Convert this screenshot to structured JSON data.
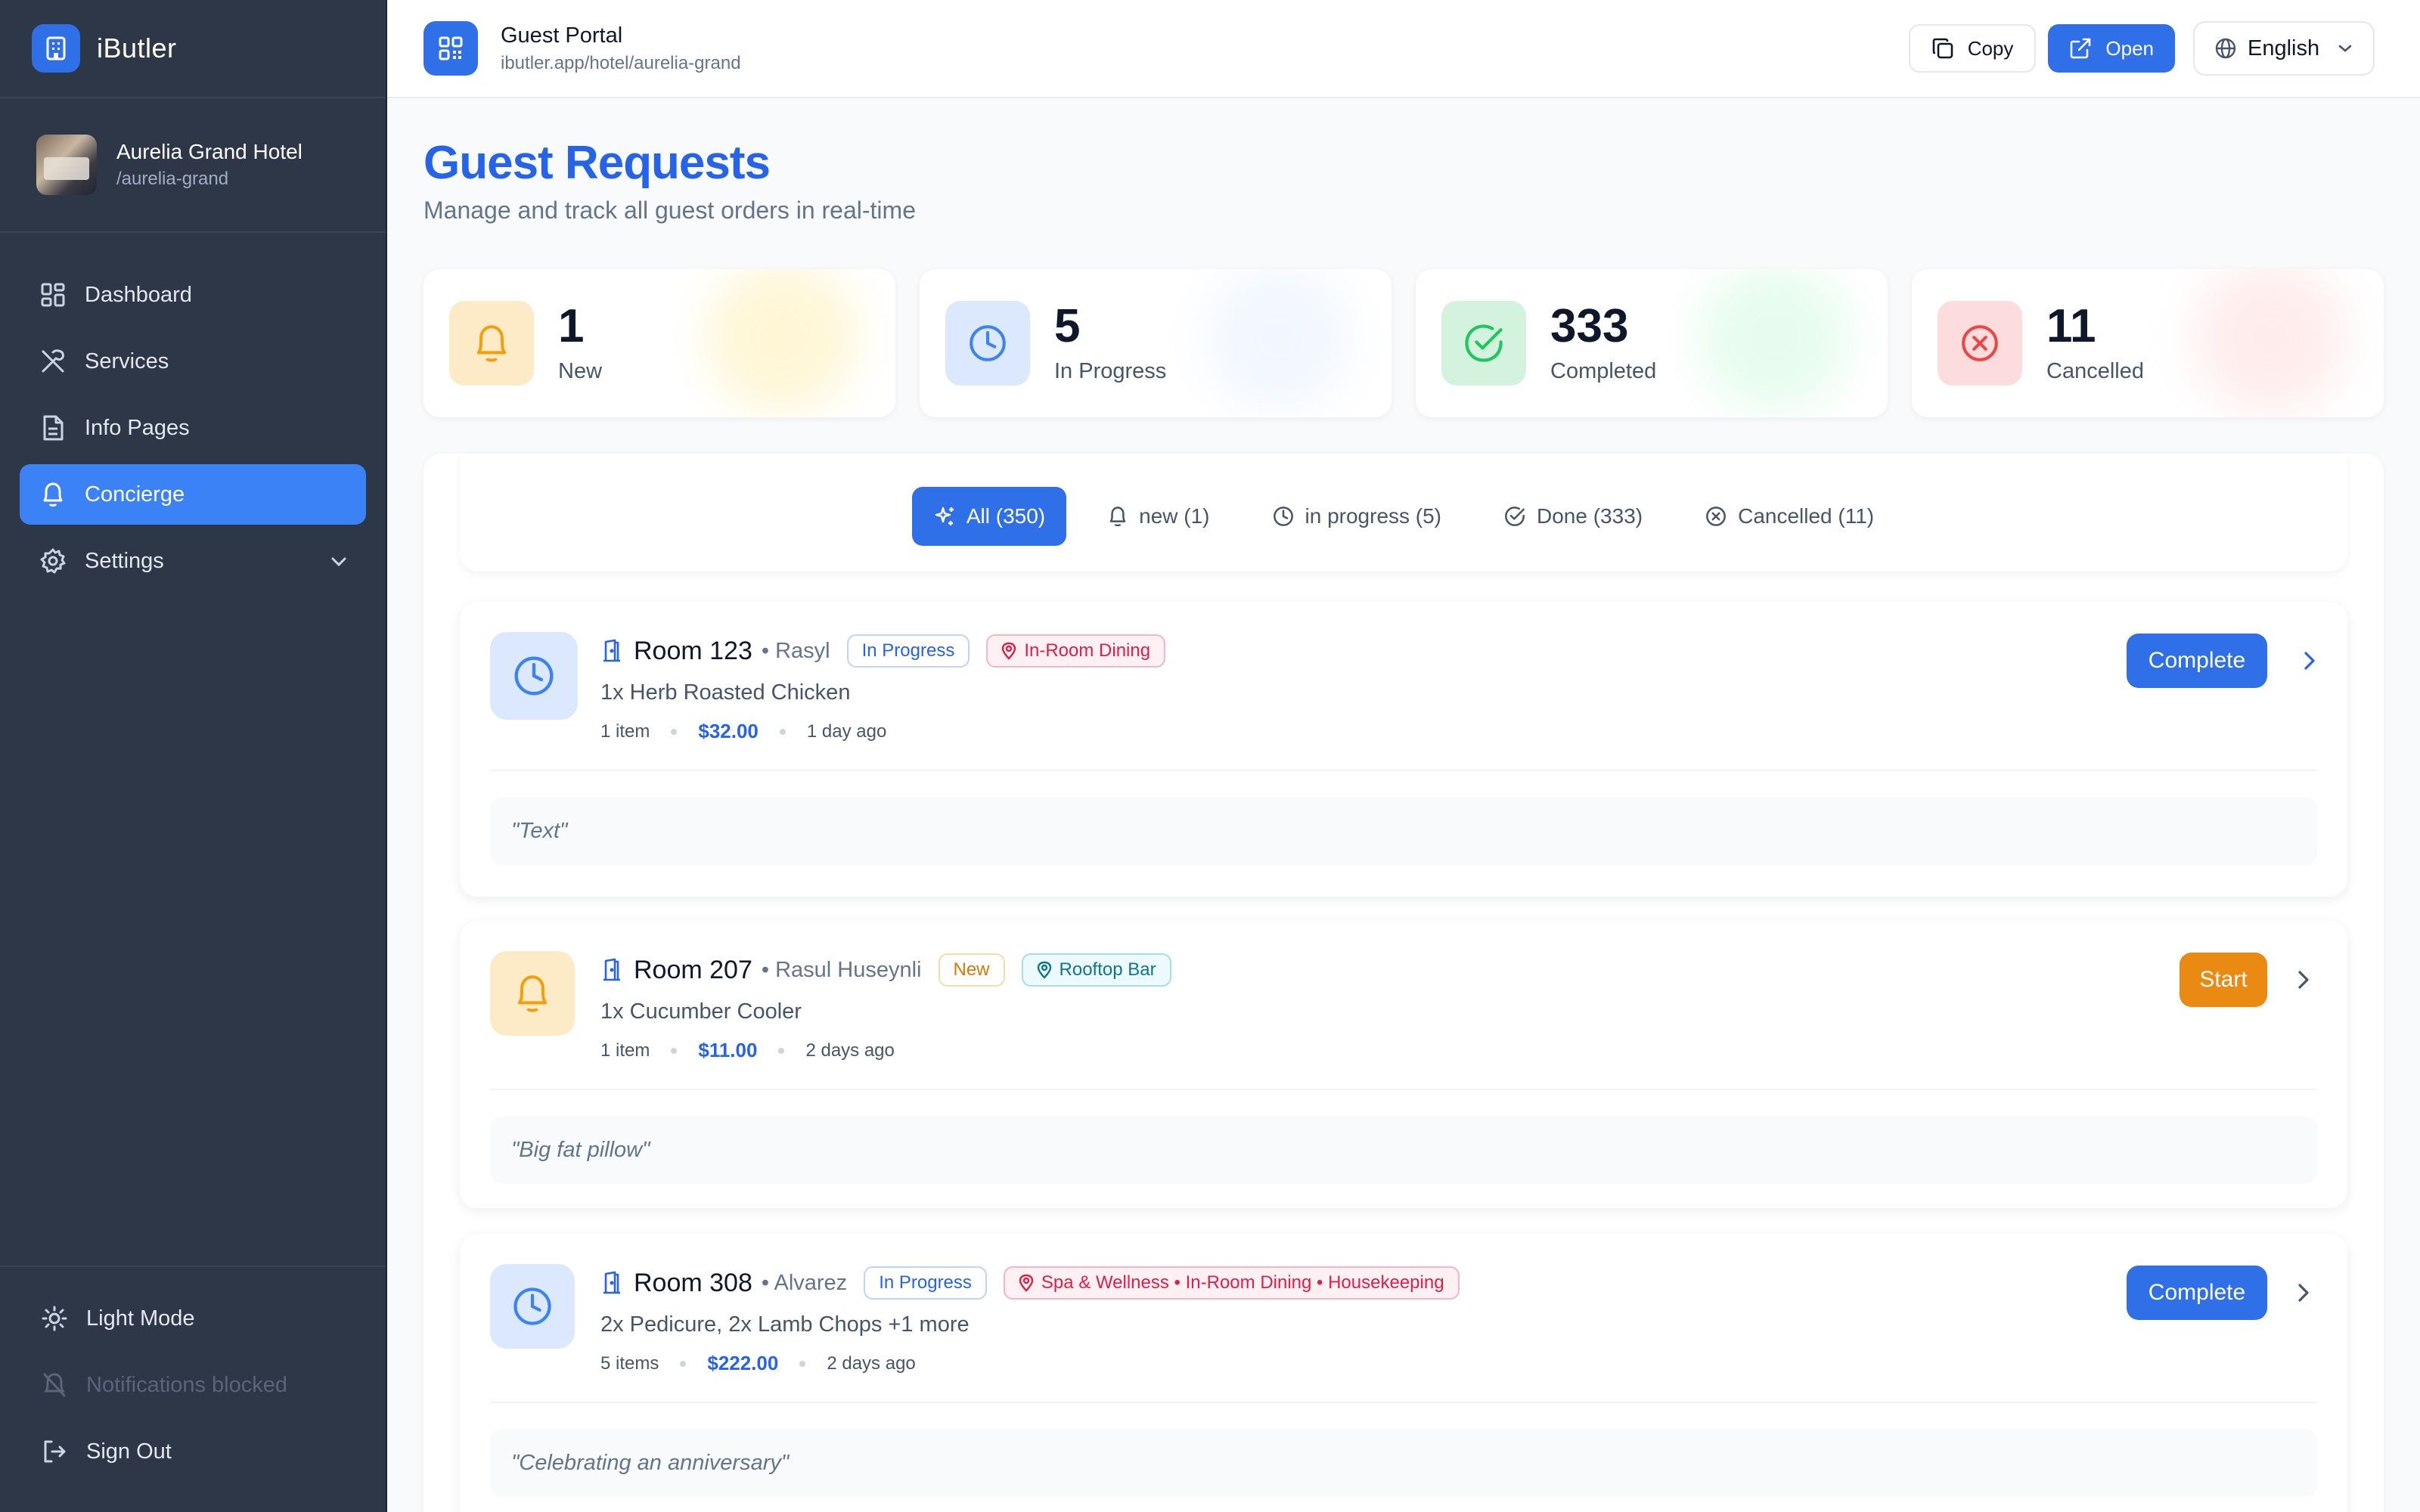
{
  "app": {
    "name": "iButler"
  },
  "hotel": {
    "name": "Aurelia Grand Hotel",
    "slug": "/aurelia-grand"
  },
  "nav": [
    {
      "label": "Dashboard",
      "icon": "dashboard-icon"
    },
    {
      "label": "Services",
      "icon": "utensils-icon"
    },
    {
      "label": "Info Pages",
      "icon": "document-icon"
    },
    {
      "label": "Concierge",
      "icon": "bell-icon",
      "active": true
    },
    {
      "label": "Settings",
      "icon": "gear-icon"
    }
  ],
  "sidebar_bottom": {
    "theme": "Light Mode",
    "notifications": "Notifications blocked",
    "signout": "Sign Out"
  },
  "topbar": {
    "title": "Guest Portal",
    "url": "ibutler.app/hotel/aurelia-grand",
    "copy_label": "Copy",
    "open_label": "Open",
    "language": "English"
  },
  "page": {
    "title": "Guest Requests",
    "subtitle": "Manage and track all guest orders in real-time"
  },
  "stats": [
    {
      "value": "1",
      "label": "New",
      "color": "#f59e0b"
    },
    {
      "value": "5",
      "label": "In Progress",
      "color": "#3b82f6"
    },
    {
      "value": "333",
      "label": "Completed",
      "color": "#22c55e"
    },
    {
      "value": "11",
      "label": "Cancelled",
      "color": "#ef4444"
    }
  ],
  "filters": [
    {
      "label": "All (350)",
      "active": true
    },
    {
      "label": "new (1)"
    },
    {
      "label": "in progress (5)"
    },
    {
      "label": "Done (333)"
    },
    {
      "label": "Cancelled (11)"
    }
  ],
  "requests": [
    {
      "room": "Room 123",
      "guest": "• Rasyl",
      "status": "In Progress",
      "location": "In-Room Dining",
      "items": "1x Herb Roasted Chicken",
      "count": "1 item",
      "price": "$32.00",
      "time": "1 day ago",
      "note": "\"Text\"",
      "action": "Complete"
    },
    {
      "room": "Room 207",
      "guest": "• Rasul Huseynli",
      "status": "New",
      "location": "Rooftop Bar",
      "items": "1x Cucumber Cooler",
      "count": "1 item",
      "price": "$11.00",
      "time": "2 days ago",
      "note": "\"Big fat pillow\"",
      "action": "Start"
    },
    {
      "room": "Room 308",
      "guest": "• Alvarez",
      "status": "In Progress",
      "location": "Spa & Wellness • In-Room Dining • Housekeeping",
      "items": "2x Pedicure, 2x Lamb Chops +1 more",
      "count": "5 items",
      "price": "$222.00",
      "time": "2 days ago",
      "note": "\"Celebrating an anniversary\"",
      "action": "Complete"
    }
  ]
}
